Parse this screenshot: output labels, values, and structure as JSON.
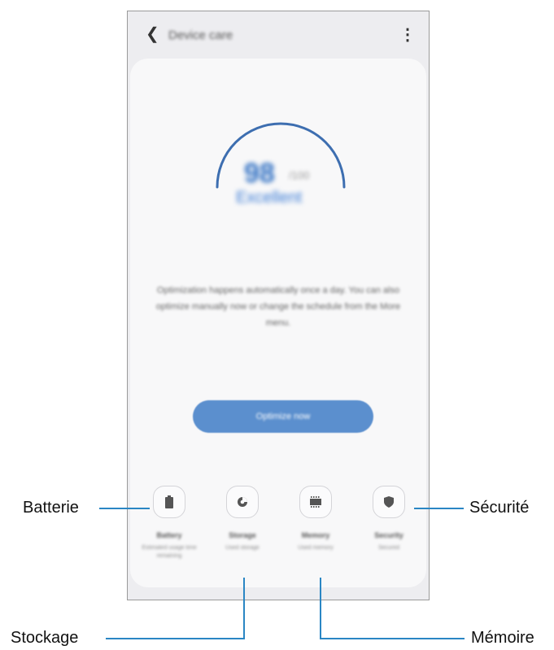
{
  "app": {
    "title": "Device care",
    "back_icon": "chevron-left-icon",
    "more_icon": "more-vertical-icon"
  },
  "score": {
    "value": "98",
    "unit": "/100",
    "status": "Excellent"
  },
  "description": "Optimization happens automatically once a day. You can also optimize manually now or change the schedule from the More menu.",
  "optimize_button": "Optimize now",
  "items": [
    {
      "label": "Battery",
      "sub": "Estimated usage time remaining",
      "icon": "battery-icon"
    },
    {
      "label": "Storage",
      "sub": "Used storage",
      "icon": "storage-icon"
    },
    {
      "label": "Memory",
      "sub": "Used memory",
      "icon": "memory-icon"
    },
    {
      "label": "Security",
      "sub": "Secured",
      "icon": "shield-icon"
    }
  ],
  "callouts": {
    "battery": "Batterie",
    "storage": "Stockage",
    "memory": "Mémoire",
    "security": "Sécurité"
  },
  "colors": {
    "accent": "#2f6fc2",
    "button": "#5b8fce",
    "callout_line": "#2a86c4"
  }
}
